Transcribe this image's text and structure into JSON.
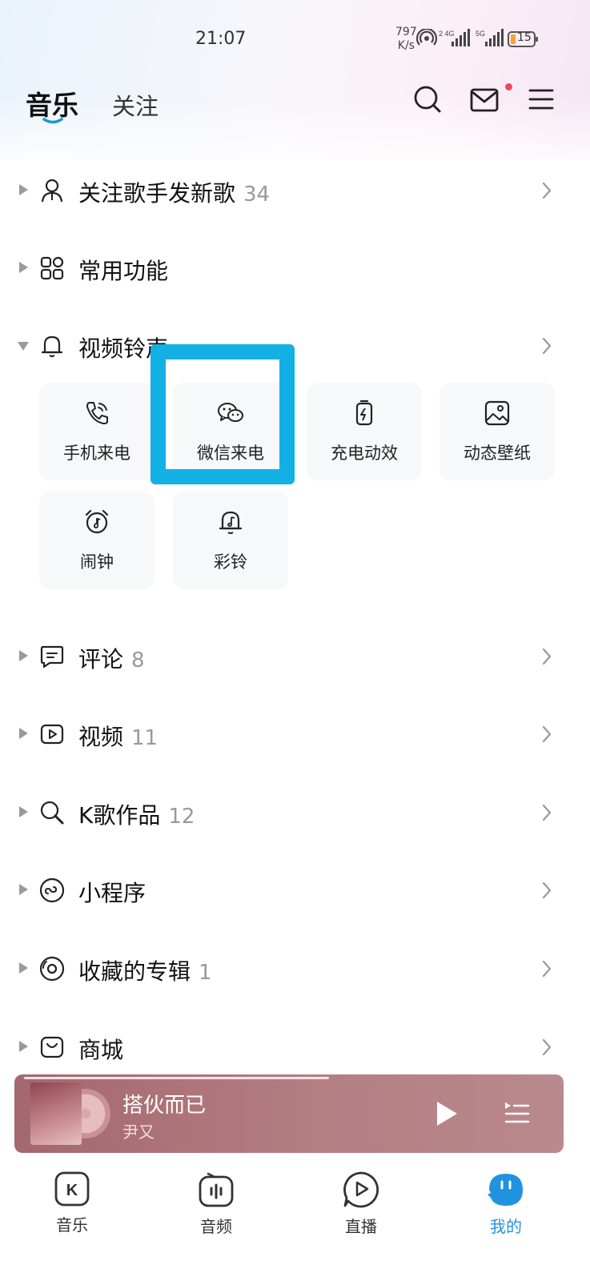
{
  "status_bar": {
    "time": "21:07",
    "speed_value": "797",
    "speed_unit": "K/s",
    "battery": "15"
  },
  "header": {
    "tab_music": "音乐",
    "tab_follow": "关注"
  },
  "rows": {
    "follow_singers": {
      "label": "关注歌手发新歌",
      "count": "34"
    },
    "common_functions": {
      "label": "常用功能"
    },
    "video_ringtone": {
      "label": "视频铃声"
    },
    "comments": {
      "label": "评论",
      "count": "8"
    },
    "videos": {
      "label": "视频",
      "count": "11"
    },
    "karaoke": {
      "label": "K歌作品",
      "count": "12"
    },
    "mini_programs": {
      "label": "小程序"
    },
    "albums": {
      "label": "收藏的专辑",
      "count": "1"
    },
    "mall": {
      "label": "商城"
    }
  },
  "ringtone_tiles": {
    "phone": "手机来电",
    "wechat": "微信来电",
    "charging": "充电动效",
    "wallpaper": "动态壁纸",
    "alarm": "闹钟",
    "color_ring": "彩铃"
  },
  "player": {
    "song": "搭伙而已",
    "artist": "尹又",
    "progress": 0.56
  },
  "nav": {
    "music": "音乐",
    "audio": "音频",
    "live": "直播",
    "mine": "我的"
  },
  "colors": {
    "accent": "#13b0e6",
    "nav_active": "#1f93e0",
    "player_bg": "#a4676f"
  }
}
